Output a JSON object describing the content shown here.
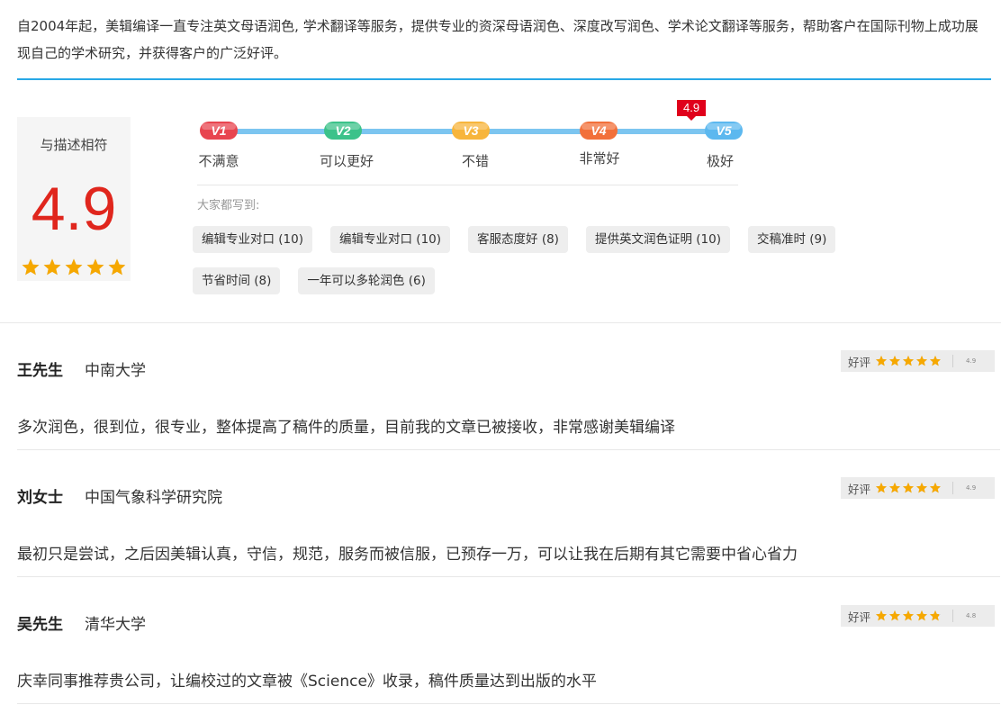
{
  "intro": {
    "text": "自2004年起，美辑编译一直专注英文母语润色, 学术翻译等服务，提供专业的资深母语润色、深度改写润色、学术论文翻译等服务，帮助客户在国际刊物上成功展现自己的学术研究，并获得客户的广泛好评。"
  },
  "summary": {
    "label": "与描述相符",
    "score": "4.9",
    "stars": 4.9,
    "star_color": "#f6a800"
  },
  "scale": {
    "marker_value": "4.9",
    "levels": [
      {
        "badge": "V1",
        "label": "不满意",
        "color": "#e8454f"
      },
      {
        "badge": "V2",
        "label": "可以更好",
        "color": "#3cc28a"
      },
      {
        "badge": "V3",
        "label": "不错",
        "color": "#f7b53c"
      },
      {
        "badge": "V4",
        "label": "非常好",
        "color": "#f2703a"
      },
      {
        "badge": "V5",
        "label": "极好",
        "color": "#5cb8ef"
      }
    ]
  },
  "tags": {
    "title": "大家都写到:",
    "items": [
      "编辑专业对口 (10)",
      "编辑专业对口 (10)",
      "客服态度好 (8)",
      "提供英文润色证明 (10)",
      "交稿准时 (9)",
      "节省时间 (8)",
      "一年可以多轮润色 (6)"
    ]
  },
  "reviews": [
    {
      "name": "王先生",
      "org": "中南大学",
      "rating_word": "好评",
      "rating": "4.9",
      "text": "多次润色，很到位，很专业，整体提高了稿件的质量，目前我的文章已被接收，非常感谢美辑编译"
    },
    {
      "name": "刘女士",
      "org": "中国气象科学研究院",
      "rating_word": "好评",
      "rating": "4.9",
      "text": "最初只是尝试，之后因美辑认真，守信，规范，服务而被信服，已预存一万，可以让我在后期有其它需要中省心省力"
    },
    {
      "name": "吴先生",
      "org": "清华大学",
      "rating_word": "好评",
      "rating": "4.8",
      "text": "庆幸同事推荐贵公司，让编校过的文章被《Science》收录，稿件质量达到出版的水平"
    }
  ]
}
